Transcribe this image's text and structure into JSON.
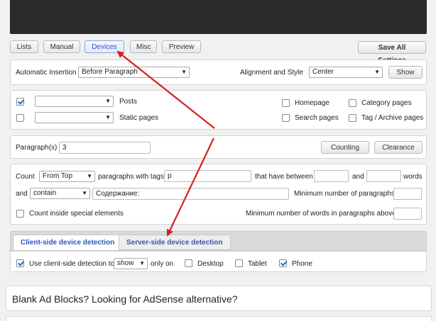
{
  "toolbar": {
    "lists": "Lists",
    "manual": "Manual",
    "devices": "Devices",
    "misc": "Misc",
    "preview": "Preview",
    "save_all": "Save All Settings"
  },
  "insertion": {
    "label": "Automatic Insertion",
    "value": "Before Paragraph",
    "align_label": "Alignment and Style",
    "align_value": "Center",
    "show_button": "Show"
  },
  "pages": {
    "posts": "Posts",
    "static_pages": "Static pages",
    "homepage": "Homepage",
    "search_pages": "Search pages",
    "category_pages": "Category pages",
    "tag_archive_pages": "Tag / Archive pages",
    "posts_checked": true
  },
  "paragraphs": {
    "label": "Paragraph(s)",
    "value": "3",
    "counting": "Counting",
    "clearance": "Clearance"
  },
  "counting": {
    "count": "Count",
    "from_top": "From Top",
    "with_tags": "paragraphs with tags",
    "tags_value": "p",
    "between": "that have between",
    "and": "and",
    "words": "words",
    "and2": "and",
    "contain": "contain",
    "contain_text": "Содержание:",
    "min_paragraphs": "Minimum number of paragraphs",
    "count_inside": "Count inside special elements",
    "min_words_above": "Minimum number of words in paragraphs above"
  },
  "tabs": {
    "client": "Client-side device detection",
    "server": "Server-side device detection"
  },
  "detection": {
    "use_client": "Use client-side detection to",
    "show": "show",
    "only_on": "only on",
    "desktop": "Desktop",
    "tablet": "Tablet",
    "phone": "Phone"
  },
  "banner": {
    "text": "Blank Ad Blocks? Looking for AdSense alternative?"
  },
  "colors": {
    "accent": "#2b56c0",
    "arrow": "#d42020"
  }
}
